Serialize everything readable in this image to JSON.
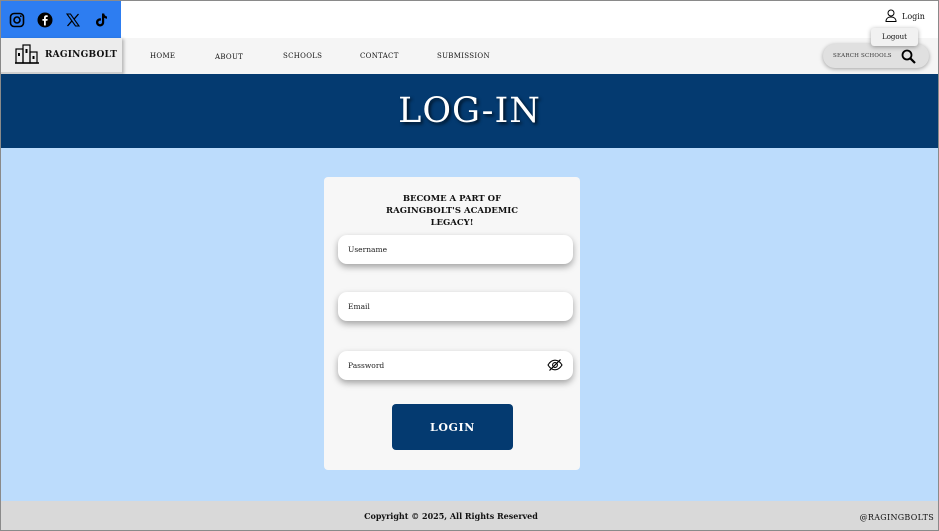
{
  "social": {
    "icons": [
      "instagram-icon",
      "facebook-icon",
      "x-icon",
      "tiktok-icon"
    ],
    "background": "#2d7df1"
  },
  "account": {
    "login_label": "Login",
    "logout_label": "Logout"
  },
  "brand": {
    "name": "RAGINGBOLT"
  },
  "nav": {
    "items": [
      "HOME",
      "ABOUT",
      "SCHOOLS",
      "CONTACT",
      "SUBMISSION"
    ]
  },
  "search": {
    "placeholder": "SEARCH SCHOOLS"
  },
  "hero": {
    "title": "LOG-IN",
    "background": "#043a70"
  },
  "form": {
    "title": "BECOME A PART OF RAGINGBOLT'S ACADEMIC LEGACY!",
    "username_placeholder": "Username",
    "email_placeholder": "Email",
    "password_placeholder": "Password",
    "submit_label": "LOGIN"
  },
  "footer": {
    "copyright": "Copyright © 2025, All Rights Reserved",
    "handle": "@RAGINGBOLTS"
  },
  "colors": {
    "page_background": "#bcdcfc",
    "accent": "#043a70"
  }
}
